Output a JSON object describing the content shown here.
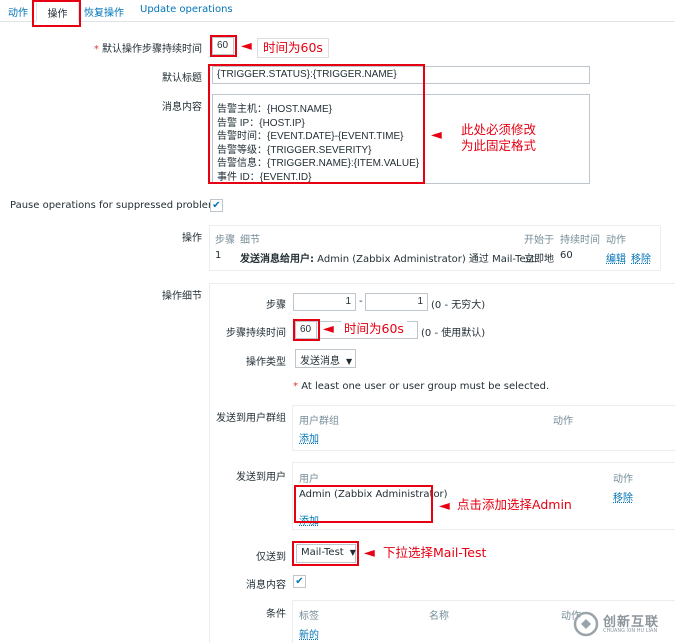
{
  "tabs": {
    "actions": "动作",
    "operations": "操作",
    "recovery": "恢复操作",
    "update": "Update operations"
  },
  "form": {
    "default_duration_label": "默认操作步骤持续时间",
    "default_duration_value": "60",
    "default_subject_label": "默认标题",
    "default_subject_value": "{TRIGGER.STATUS}:{TRIGGER.NAME}",
    "default_message_label": "消息内容",
    "default_message_lines": [
      "告警主机：{HOST.NAME}",
      "告警 IP：{HOST.IP}",
      "告警时间：{EVENT.DATE}-{EVENT.TIME}",
      "告警等级：{TRIGGER.SEVERITY}",
      "告警信息：{TRIGGER.NAME}:{ITEM.VALUE}",
      "事件 ID：{EVENT.ID}"
    ],
    "pause_label": "Pause operations for suppressed problems",
    "operations_label": "操作",
    "op_table": {
      "headers": [
        "步骤",
        "细节",
        "开始于",
        "持续时间",
        "动作"
      ],
      "row": {
        "step": "1",
        "detail_bold": "发送消息给用户:",
        "detail_rest": " Admin (Zabbix Administrator) 通过 Mail-Test",
        "start": "立即地",
        "duration": "60",
        "edit": "编辑",
        "remove": "移除"
      }
    },
    "op_details_label": "操作细节",
    "steps_label": "步骤",
    "step_from": "1",
    "step_dash": "-",
    "step_to": "1",
    "step_hint": "(0 - 无穷大)",
    "step_duration_label": "步骤持续时间",
    "step_duration_value": "60",
    "step_duration_hint": "(0 - 使用默认)",
    "op_type_label": "操作类型",
    "op_type_value": "发送消息",
    "required_note": "At least one user or user group must be selected.",
    "send_group_label": "发送到用户群组",
    "group_table": {
      "col1": "用户群组",
      "col2": "动作",
      "add": "添加"
    },
    "send_user_label": "发送到用户",
    "user_table": {
      "col1": "用户",
      "col2": "动作",
      "user": "Admin (Zabbix Administrator)",
      "remove": "移除",
      "add": "添加"
    },
    "send_only_label": "仅送到",
    "send_only_value": "Mail-Test",
    "message_content_label": "消息内容",
    "conditions_label": "条件",
    "cond_table": {
      "col1": "标签",
      "col2": "名称",
      "col3": "动作",
      "new": "新的"
    }
  },
  "annotations": {
    "duration_60s_top": "时间为60s",
    "must_modify_line1": "此处必须修改",
    "must_modify_line2": "为此固定格式",
    "duration_60s_step": "时间为60s",
    "click_add_admin": "点击添加选择Admin",
    "dropdown_select": "下拉选择Mail-Test"
  },
  "watermark": {
    "brand": "创新互联",
    "sub": "CHUANG XIN HU LIAN"
  },
  "colors": {
    "annotation_red": "#e60012",
    "link_blue": "#0275b8"
  }
}
